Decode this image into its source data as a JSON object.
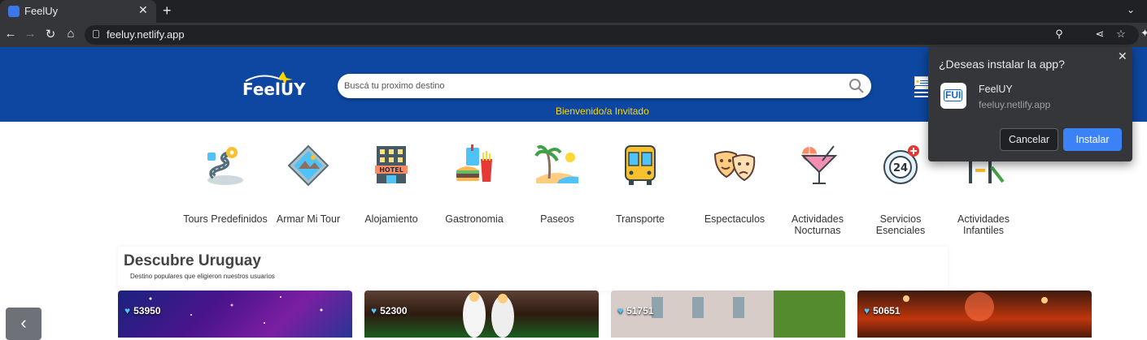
{
  "browser": {
    "tab_title": "FeelUy",
    "tab_close_icon": "close-icon",
    "new_tab_icon": "plus-icon",
    "url": "feeluy.netlify.app",
    "accent": "#3b82f6"
  },
  "header": {
    "logo_text": "FeelUY",
    "search_placeholder": "Buscá tu proximo destino",
    "welcome": "Bienvenido/a Invitado",
    "brand_color": "#0d47a1",
    "welcome_color": "#ffd600"
  },
  "categories": [
    {
      "label": "Tours Predefinidos",
      "icon": "map-route-icon"
    },
    {
      "label": "Armar Mi Tour",
      "icon": "tour-builder-icon"
    },
    {
      "label": "Alojamiento",
      "icon": "hotel-icon"
    },
    {
      "label": "Gastronomia",
      "icon": "food-icon"
    },
    {
      "label": "Paseos",
      "icon": "beach-icon"
    },
    {
      "label": "Transporte",
      "icon": "bus-icon"
    },
    {
      "label": "Espectaculos",
      "icon": "theater-masks-icon"
    },
    {
      "label": "Actividades Nocturnas",
      "icon": "cocktail-icon"
    },
    {
      "label": "Servicios Esenciales",
      "icon": "24h-service-icon"
    },
    {
      "label": "Actividades Infantiles",
      "icon": "playground-icon"
    }
  ],
  "discover": {
    "title": "Descubre Uruguay",
    "subtitle": "Destino populares que eligieron nuestros usuarios"
  },
  "cards": [
    {
      "likes": "53950"
    },
    {
      "likes": "52300"
    },
    {
      "likes": "51751"
    },
    {
      "likes": "50651"
    }
  ],
  "install_popup": {
    "title": "¿Deseas instalar la app?",
    "app_name": "FeelUY",
    "app_url": "feeluy.netlify.app",
    "app_icon_text": "FUI",
    "cancel_label": "Cancelar",
    "install_label": "Instalar"
  }
}
